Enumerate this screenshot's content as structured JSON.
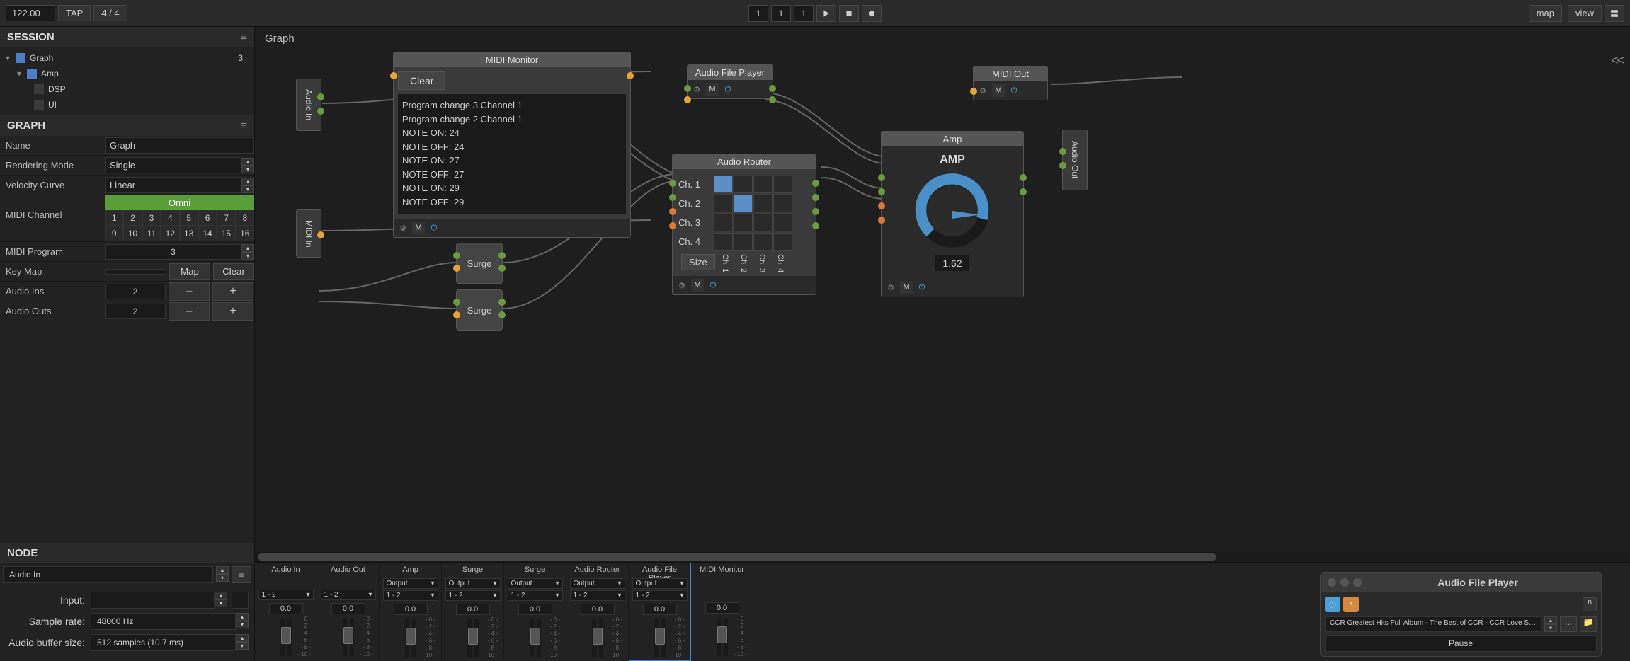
{
  "topbar": {
    "bpm": "122.00",
    "tap": "TAP",
    "timesig": "4 / 4",
    "counter": [
      "1",
      "1",
      "1"
    ],
    "map": "map",
    "view": "view"
  },
  "session": {
    "header": "SESSION",
    "tree": {
      "root": "Graph",
      "root_badge": "3",
      "amp": "Amp",
      "dsp": "DSP",
      "ui": "UI"
    }
  },
  "graph_props": {
    "header": "GRAPH",
    "name_lbl": "Name",
    "name_val": "Graph",
    "render_lbl": "Rendering Mode",
    "render_val": "Single",
    "vel_lbl": "Velocity Curve",
    "vel_val": "Linear",
    "midi_ch_lbl": "MIDI Channel",
    "omni": "Omni",
    "channels": [
      "1",
      "2",
      "3",
      "4",
      "5",
      "6",
      "7",
      "8",
      "9",
      "10",
      "11",
      "12",
      "13",
      "14",
      "15",
      "16"
    ],
    "midi_prog_lbl": "MIDI Program",
    "midi_prog_val": "3",
    "keymap_lbl": "Key Map",
    "map_btn": "Map",
    "clear_btn": "Clear",
    "audio_ins_lbl": "Audio Ins",
    "audio_ins_val": "2",
    "audio_outs_lbl": "Audio Outs",
    "audio_outs_val": "2",
    "minus": "–",
    "plus": "+"
  },
  "node_panel": {
    "header": "NODE",
    "selected": "Audio In",
    "input_lbl": "Input:",
    "samplerate_lbl": "Sample rate:",
    "samplerate_val": "48000 Hz",
    "buffer_lbl": "Audio buffer size:",
    "buffer_val": "512 samples (10.7 ms)"
  },
  "canvas": {
    "title": "Graph",
    "collapse": "<<",
    "nodes": {
      "audio_in": "Audio In",
      "midi_in": "MIDI In",
      "audio_out": "Audio Out",
      "midi_monitor": "MIDI Monitor",
      "mon_clear": "Clear",
      "mon_log": [
        "Program change 3 Channel 1",
        "Program change 2 Channel 1",
        "NOTE ON: 24",
        "NOTE OFF: 24",
        "NOTE ON: 27",
        "NOTE OFF: 27",
        "NOTE ON: 29",
        "NOTE OFF: 29"
      ],
      "afp_title": "Audio File Player",
      "surge1": "Surge",
      "surge2": "Surge",
      "router_title": "Audio Router",
      "router_rows": [
        "Ch. 1",
        "Ch. 2",
        "Ch. 3",
        "Ch. 4"
      ],
      "router_cols": [
        "Ch. 1",
        "Ch. 2",
        "Ch. 3",
        "Ch. 4"
      ],
      "size": "Size",
      "amp_title": "Amp",
      "amp_label": "AMP",
      "amp_val": "1.62",
      "midi_out": "MIDI Out"
    }
  },
  "mixer": {
    "strips": [
      {
        "name": "Audio In",
        "route": "1 - 2",
        "db": "0.0"
      },
      {
        "name": "Audio Out",
        "route": "1 - 2",
        "db": "0.0"
      },
      {
        "name": "Amp",
        "out": "Output",
        "route": "1 - 2",
        "db": "0.0"
      },
      {
        "name": "Surge",
        "out": "Output",
        "route": "1 - 2",
        "db": "0.0"
      },
      {
        "name": "Surge",
        "out": "Output",
        "route": "1 - 2",
        "db": "0.0"
      },
      {
        "name": "Audio Router",
        "out": "Output",
        "route": "1 - 2",
        "db": "0.0"
      },
      {
        "name": "Audio File Player",
        "out": "Output",
        "route": "1 - 2",
        "db": "0.0",
        "sel": true
      },
      {
        "name": "MIDI Monitor",
        "db": "0.0"
      }
    ],
    "scale": [
      "- 0 -",
      "- 2 -",
      "- 4 -",
      "- 6 -",
      "- 8 -",
      "- 10 -"
    ]
  },
  "afp_window": {
    "title": "Audio File Player",
    "n": "n",
    "file": "CCR Greatest Hits Full Album - The Best of CCR - CCR Love Songs Ever [-UX...",
    "pause": "Pause"
  }
}
